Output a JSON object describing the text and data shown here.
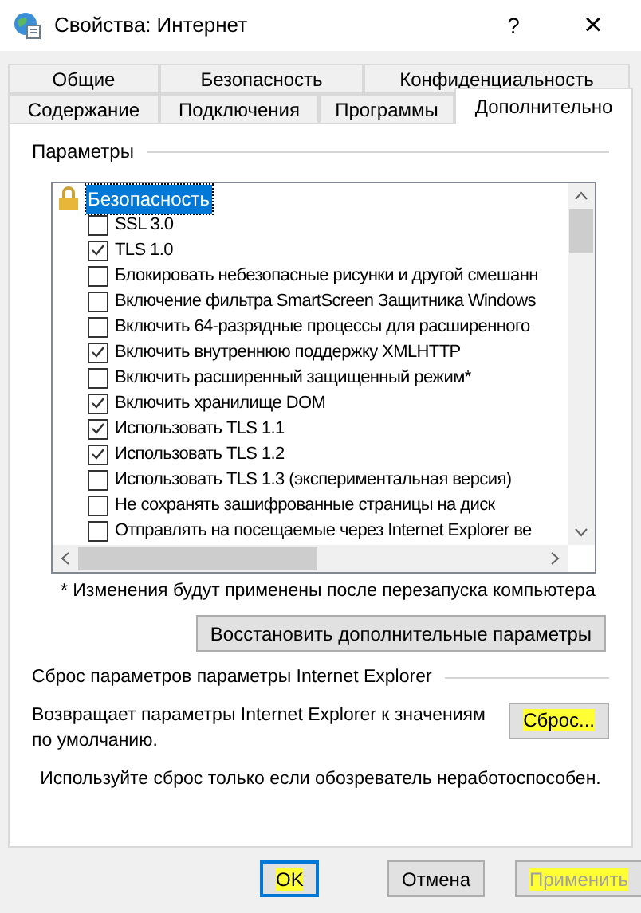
{
  "window": {
    "title": "Свойства: Интернет",
    "help": "?",
    "close": "×"
  },
  "tab_rows": [
    [
      {
        "label": "Общие",
        "selected": false
      },
      {
        "label": "Безопасность",
        "selected": false
      },
      {
        "label": "Конфиденциальность",
        "selected": false
      }
    ],
    [
      {
        "label": "Содержание",
        "selected": false
      },
      {
        "label": "Подключения",
        "selected": false
      },
      {
        "label": "Программы",
        "selected": false
      },
      {
        "label": "Дополнительно",
        "selected": true
      }
    ]
  ],
  "settings": {
    "title": "Параметры",
    "group": {
      "label": "Безопасность",
      "selected": true
    },
    "items": [
      {
        "label": "SSL 3.0",
        "checked": false
      },
      {
        "label": "TLS 1.0",
        "checked": true
      },
      {
        "label": "Блокировать небезопасные рисунки и другой смешанн",
        "checked": false
      },
      {
        "label": "Включение фильтра SmartScreen Защитника Windows",
        "checked": false
      },
      {
        "label": "Включить 64-разрядные процессы для расширенного",
        "checked": false
      },
      {
        "label": "Включить внутреннюю поддержку XMLHTTP",
        "checked": true
      },
      {
        "label": "Включить расширенный защищенный режим*",
        "checked": false
      },
      {
        "label": "Включить хранилище DOM",
        "checked": true
      },
      {
        "label": "Использовать TLS 1.1",
        "checked": true
      },
      {
        "label": "Использовать TLS 1.2",
        "checked": true
      },
      {
        "label": "Использовать TLS 1.3 (экспериментальная версия)",
        "checked": false
      },
      {
        "label": "Не сохранять зашифрованные страницы на диск",
        "checked": false
      },
      {
        "label": "Отправлять на посещаемые через Internet Explorer ве",
        "checked": false
      }
    ],
    "note": "* Изменения будут применены после перезапуска компьютера",
    "restore_button": {
      "label": "Восстановить дополнительные параметры",
      "highlighted": false
    }
  },
  "reset": {
    "title": "Сброс параметров параметры Internet Explorer",
    "description": "Возвращает параметры Internet Explorer к значениям по умолчанию.",
    "button": {
      "label": "Сброс...",
      "highlighted": true
    },
    "warning": "Используйте сброс только если обозреватель неработоспособен."
  },
  "buttons": [
    {
      "label": "OK",
      "highlighted": true,
      "default": true,
      "disabled": false
    },
    {
      "label": "Отмена",
      "highlighted": false,
      "default": false,
      "disabled": false
    },
    {
      "label": "Применить",
      "highlighted": true,
      "default": false,
      "disabled": true
    }
  ]
}
